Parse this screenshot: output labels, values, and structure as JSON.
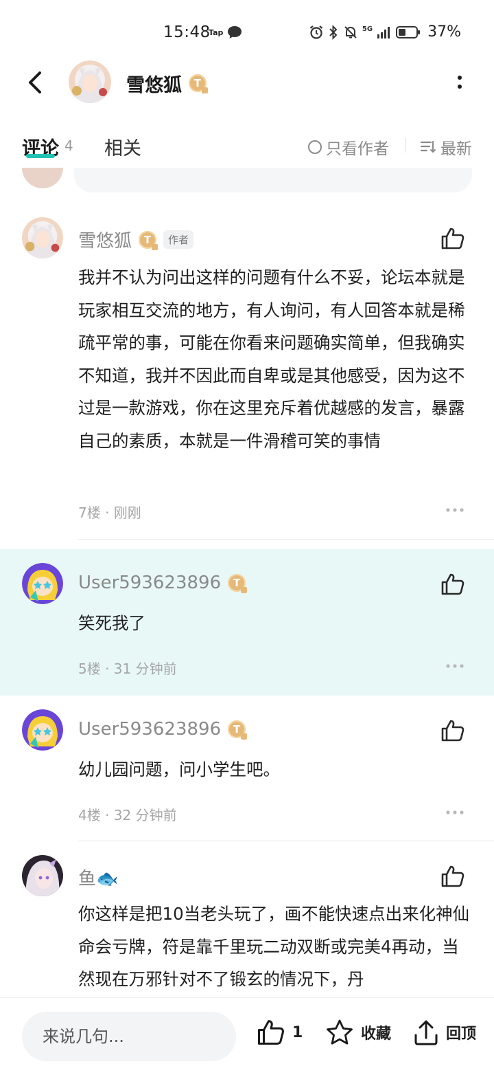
{
  "status_bar": {
    "time": "15:48",
    "tap_label": "Tap",
    "battery_percent": "37%",
    "network_label": "5G"
  },
  "header": {
    "username": "雪悠狐",
    "badge_letter": "T"
  },
  "tabs": {
    "comments_label": "评论",
    "comments_count": "4",
    "related_label": "相关",
    "only_author_label": "只看作者",
    "sort_label": "最新"
  },
  "comments": [
    {
      "name": "雪悠狐",
      "badge": "T",
      "author_tag": "作者",
      "text": "我并不认为问出这样的问题有什么不妥，论坛本就是玩家相互交流的地方，有人询问，有人回答本就是稀疏平常的事，可能在你看来问题确实简单，但我确实不知道，我并不因此而自卑或是其他感受，因为这不过是一款游戏，你在这里充斥着优越感的发言，暴露自己的素质，本就是一件滑稽可笑的事情",
      "meta": "7楼 · 刚刚"
    },
    {
      "name": "User593623896",
      "badge": "T",
      "text": "笑死我了",
      "meta": "5楼 · 31 分钟前"
    },
    {
      "name": "User593623896",
      "badge": "T",
      "text": "幼儿园问题，问小学生吧。",
      "meta": "4楼 · 32 分钟前"
    },
    {
      "name": "鱼🐟",
      "text": "你这样是把10当老头玩了，画不能快速点出来化神仙命会亏牌，符是靠千里玩二动双断或完美4再动，当然现在万邪针对不了锻玄的情况下，丹"
    }
  ],
  "bottom_bar": {
    "input_placeholder": "来说几句...",
    "like_count": "1",
    "favorite_label": "收藏",
    "top_label": "回顶"
  },
  "colors": {
    "accent": "#23c3b2",
    "highlight_bg": "#e8f8f7",
    "badge_gold": "#e6b978"
  }
}
